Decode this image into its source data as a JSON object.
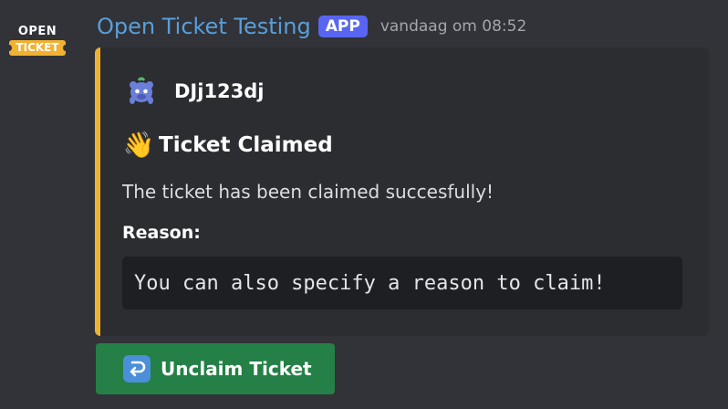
{
  "message": {
    "avatar": {
      "logo_line1": "OPEN",
      "logo_line2": "TICKET",
      "logo_color": "#f0b232"
    },
    "header": {
      "username": "Open Ticket Testing",
      "username_color": "#5a9ed8",
      "badge": "APP",
      "badge_color": "#5865f2",
      "timestamp": "vandaag om 08:52"
    },
    "embed": {
      "accent_color": "#f0b232",
      "author": {
        "icon": "discord-mascot-icon",
        "name": "DJj123dj"
      },
      "title": {
        "emoji": "👋",
        "emoji_name": "waving-hand-icon",
        "text": "Ticket Claimed"
      },
      "description": "The ticket has been claimed succesfully!",
      "field": {
        "name": "Reason:",
        "value": "You can also specify a reason to claim!"
      }
    },
    "button": {
      "label": "Unclaim Ticket",
      "icon": "return-arrow-icon",
      "color": "#248046"
    }
  }
}
